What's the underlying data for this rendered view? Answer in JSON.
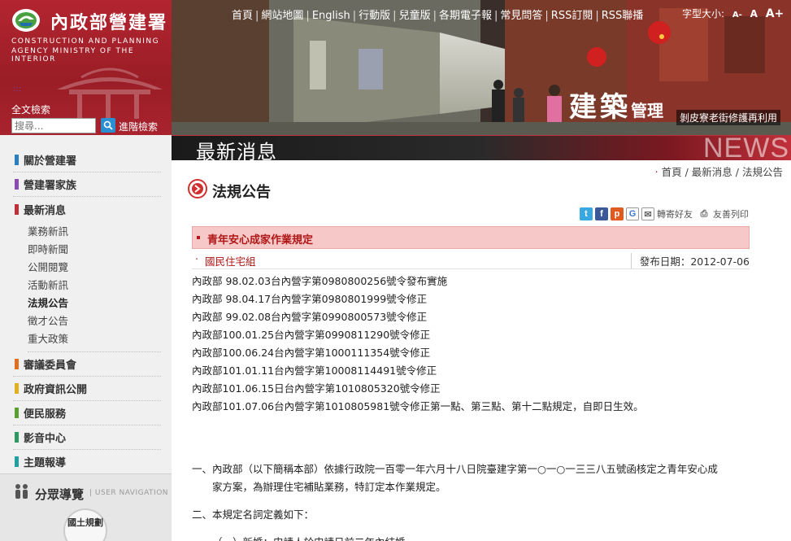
{
  "logo": {
    "title": "內政部營建署",
    "en_line1": "CONSTRUCTION AND PLANNING",
    "en_line2": "AGENCY MINISTRY OF THE INTERIOR"
  },
  "search": {
    "label": "全文檢索",
    "placeholder": "搜尋...",
    "advanced": "進階檢索"
  },
  "topnav": [
    "首頁",
    "網站地圖",
    "English",
    "行動版",
    "兒童版",
    "各期電子報",
    "常見問答",
    "RSS訂閱",
    "RSS聯播"
  ],
  "fontsize": {
    "label": "字型大小:",
    "small": "A-",
    "normal": "A",
    "large": "A+"
  },
  "banner": {
    "caption_big": "建築",
    "caption_mid": "管理",
    "caption_small": "剝皮寮老街修護再利用"
  },
  "section": {
    "title": "最新消息",
    "en": "NEWS"
  },
  "nav": {
    "items": [
      {
        "label": "關於營建署",
        "color": "#2a7fc0"
      },
      {
        "label": "營建署家族",
        "color": "#8a4cb0"
      },
      {
        "label": "最新消息",
        "color": "#c0303a"
      }
    ],
    "sub": [
      "業務新訊",
      "即時新聞",
      "公開閱覽",
      "活動新訊",
      "法規公告",
      "徵才公告",
      "重大政策"
    ],
    "items2": [
      {
        "label": "審議委員會",
        "color": "#e07020"
      },
      {
        "label": "政府資訊公開",
        "color": "#e0b020"
      },
      {
        "label": "便民服務",
        "color": "#5aa030"
      },
      {
        "label": "影音中心",
        "color": "#2a9a60"
      },
      {
        "label": "主題報導",
        "color": "#20a0a0"
      }
    ]
  },
  "user_nav": {
    "title": "分眾導覽",
    "en": "| USER NAVIGATION",
    "guide": "國土規劃"
  },
  "breadcrumb": [
    "首頁",
    "最新消息",
    "法規公告"
  ],
  "page_heading": "法規公告",
  "share": {
    "forward": "轉寄好友",
    "print": "友善列印"
  },
  "article": {
    "title": "青年安心成家作業規定",
    "unit": "國民住宅組",
    "date": "發布日期：2012-07-06",
    "history": [
      "內政部  98.02.03台內營字第0980800256號令發布實施",
      "內政部  98.04.17台內營字第0980801999號令修正",
      "內政部  99.02.08台內營字第0990800573號令修正",
      "內政部100.01.25台內營字第0990811290號令修正",
      "內政部100.06.24台內營字第1000111354號令修正",
      "內政部101.01.11台內營字第10008114491號令修正",
      "內政部101.06.15日台內營字第1010805320號令修正",
      "內政部101.07.06台內營字第1010805981號令修正第一點、第三點、第十二點規定，自即日生效。"
    ],
    "para1_a": "一、內政部（以下簡稱本部）依據行政院一百零一年六月十八日院臺建字第一○一○一三三八五號函核定之青年安心成",
    "para1_b": "家方案，為辦理住宅補貼業務，特訂定本作業規定。",
    "para2": "二、本規定名詞定義如下：",
    "para3": "（一）新婚：申請人於申請日前二年內結婚。"
  }
}
